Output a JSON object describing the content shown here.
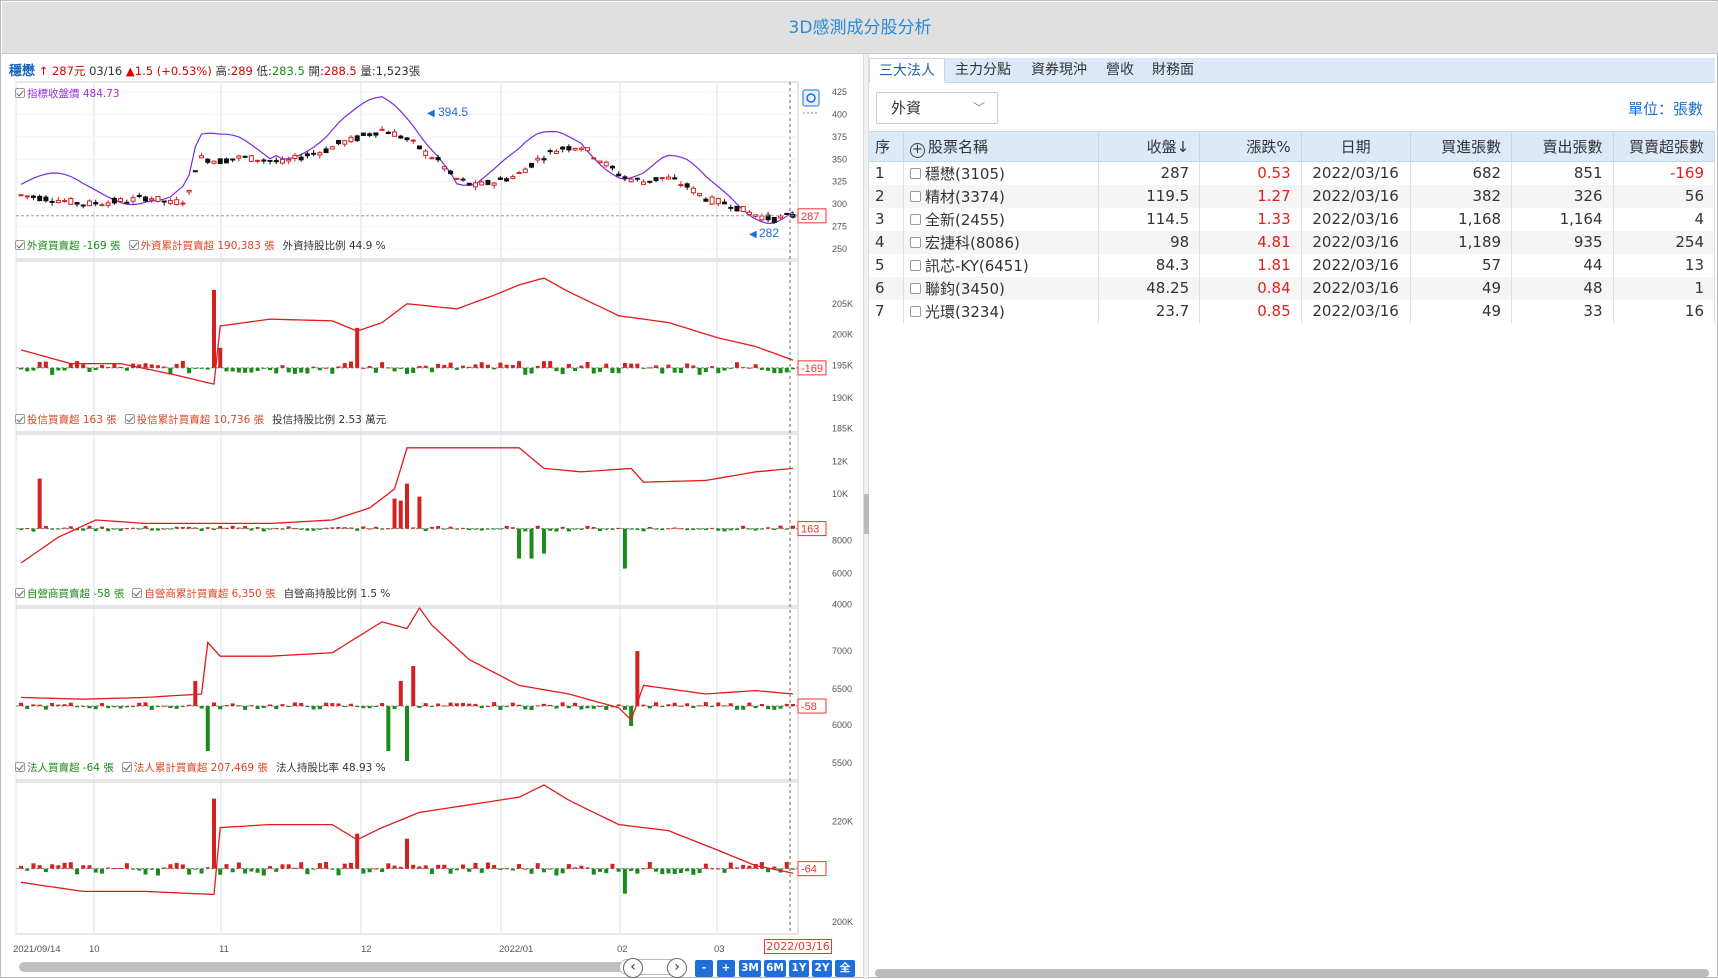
{
  "app": {
    "title": "3D感測成分股分析"
  },
  "stock": {
    "name": "穩懋",
    "arrow": "↑",
    "price": "287元",
    "date": "03/16",
    "change_arrow": "▲",
    "change": "1.5 (+0.53%)",
    "high_label": "高:",
    "high": "289",
    "low_label": "低:",
    "low": "283.5",
    "open_label": "開:",
    "open": "288.5",
    "vol_label": "量:",
    "vol": "1,523張"
  },
  "panels": {
    "price": {
      "legend": "指標收盤價 484.73",
      "max_label": "394.5",
      "min_label": "282",
      "last_label": "287",
      "yticks": [
        "425",
        "400",
        "375",
        "350",
        "325",
        "300",
        "275",
        "250"
      ]
    },
    "foreign": {
      "l1": "外資買賣超 -169 張",
      "l2": "外資累計買賣超 190,383 張",
      "l3": "外資持股比例 44.9 %",
      "last_label": "-169",
      "yticks": [
        "205K",
        "200K",
        "195K",
        "190K",
        "185K"
      ]
    },
    "trust": {
      "l1": "投信買賣超 163 張",
      "l2": "投信累計買賣超 10,736 張",
      "l3": "投信持股比例 2.53 萬元",
      "last_label": "163",
      "yticks": [
        "12K",
        "10K",
        "8000",
        "6000",
        "4000"
      ]
    },
    "dealer": {
      "l1": "自營商買賣超 -58 張",
      "l2": "自營商累計買賣超 6,350 張",
      "l3": "自營商持股比例 1.5 %",
      "last_label": "-58",
      "yticks": [
        "7000",
        "6500",
        "6000",
        "5500"
      ]
    },
    "inst": {
      "l1": "法人買賣超 -64 張",
      "l2": "法人累計買賣超 207,469 張",
      "l3": "法人持股比率 48.93 %",
      "last_label": "-64",
      "yticks": [
        "220K",
        "200K"
      ]
    }
  },
  "xaxis": {
    "labels": [
      "2021/09/14",
      "10",
      "11",
      "12",
      "2022/01",
      "02",
      "03"
    ],
    "current": "2022/03/16"
  },
  "range_buttons": [
    "-",
    "+",
    "3M",
    "6M",
    "1Y",
    "2Y",
    "全"
  ],
  "tabs": [
    "三大法人",
    "主力分點",
    "資券現沖",
    "營收",
    "財務面"
  ],
  "filter": {
    "selected": "外資",
    "unit": "單位：張數"
  },
  "table": {
    "headers": [
      "序",
      "股票名稱",
      "收盤",
      "漲跌%",
      "日期",
      "買進張數",
      "賣出張數",
      "買賣超張數"
    ],
    "sort_arrow": "↓",
    "rows": [
      {
        "no": "1",
        "name": "穩懋(3105)",
        "close": "287",
        "chg": "0.53",
        "date": "2022/03/16",
        "buy": "682",
        "sell": "851",
        "net": "-169"
      },
      {
        "no": "2",
        "name": "精材(3374)",
        "close": "119.5",
        "chg": "1.27",
        "date": "2022/03/16",
        "buy": "382",
        "sell": "326",
        "net": "56"
      },
      {
        "no": "3",
        "name": "全新(2455)",
        "close": "114.5",
        "chg": "1.33",
        "date": "2022/03/16",
        "buy": "1,168",
        "sell": "1,164",
        "net": "4"
      },
      {
        "no": "4",
        "name": "宏捷科(8086)",
        "close": "98",
        "chg": "4.81",
        "date": "2022/03/16",
        "buy": "1,189",
        "sell": "935",
        "net": "254"
      },
      {
        "no": "5",
        "name": "訊芯-KY(6451)",
        "close": "84.3",
        "chg": "1.81",
        "date": "2022/03/16",
        "buy": "57",
        "sell": "44",
        "net": "13"
      },
      {
        "no": "6",
        "name": "聯鈞(3450)",
        "close": "48.25",
        "chg": "0.84",
        "date": "2022/03/16",
        "buy": "49",
        "sell": "48",
        "net": "1"
      },
      {
        "no": "7",
        "name": "光環(3234)",
        "close": "23.7",
        "chg": "0.85",
        "date": "2022/03/16",
        "buy": "49",
        "sell": "33",
        "net": "16"
      }
    ]
  },
  "colors": {
    "up": "#d42020",
    "down": "#1a8a1a",
    "accent": "#1e6fd9",
    "index_line": "#7a2be0"
  }
}
